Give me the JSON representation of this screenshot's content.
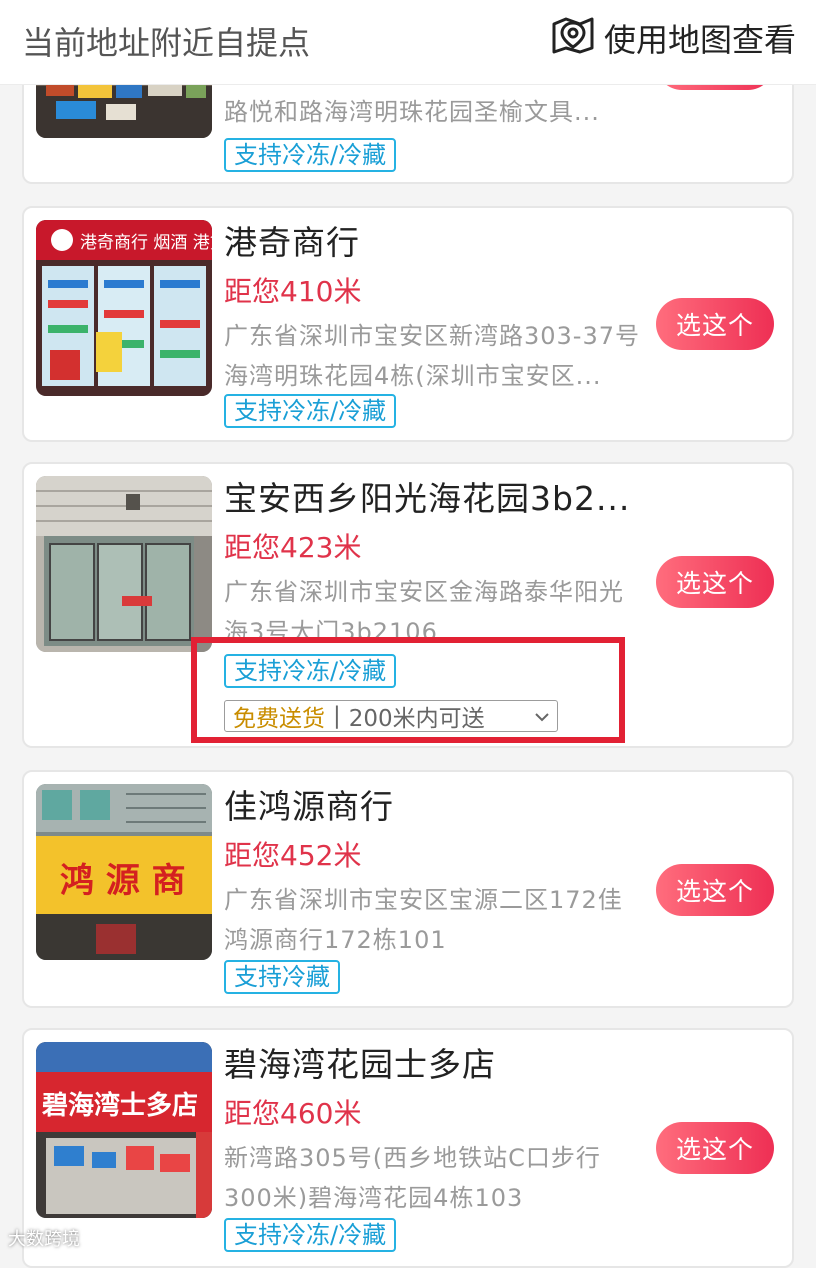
{
  "header": {
    "title": "当前地址附近自提点",
    "map_label": "使用地图查看"
  },
  "stores": [
    {
      "name": "",
      "distance": "",
      "address": "路悦和路海湾明珠花园圣榆文具...",
      "tag": "支持冷冻/冷藏",
      "button": ""
    },
    {
      "name": "港奇商行",
      "distance": "距您410米",
      "address": "广东省深圳市宝安区新湾路303-37号海湾明珠花园4栋(深圳市宝安区...",
      "tag": "支持冷冻/冷藏",
      "button": "选这个"
    },
    {
      "name": "宝安西乡阳光海花园3b2...",
      "distance": "距您423米",
      "address": "广东省深圳市宝安区金海路泰华阳光海3号大门3b2106",
      "tag": "支持冷冻/冷藏",
      "delivery_free": "免费送货",
      "delivery_range": "200米内可送",
      "button": "选这个"
    },
    {
      "name": "佳鸿源商行",
      "distance": "距您452米",
      "address": "广东省深圳市宝安区宝源二区172佳鸿源商行172栋101",
      "tag": "支持冷藏",
      "button": "选这个"
    },
    {
      "name": "碧海湾花园士多店",
      "distance": "距您460米",
      "address": "新湾路305号(西乡地铁站C口步行300米)碧海湾花园4栋103",
      "tag": "支持冷冻/冷藏",
      "button": "选这个"
    }
  ],
  "photo_signs": {
    "store2": "港奇商行 烟酒 港货",
    "store4": "鸿 源 商",
    "store5": "碧海湾士多店"
  },
  "watermark": "大数跨境",
  "colors": {
    "accent_red": "#e0334a",
    "button_gradient_start": "#ff6d7d",
    "button_gradient_end": "#ee2f54",
    "tag_blue": "#1a9fd6",
    "highlight_red": "#e22134"
  },
  "icons": {
    "map_pin": "map-pin-icon",
    "dropdown": "chevron-down-icon"
  }
}
